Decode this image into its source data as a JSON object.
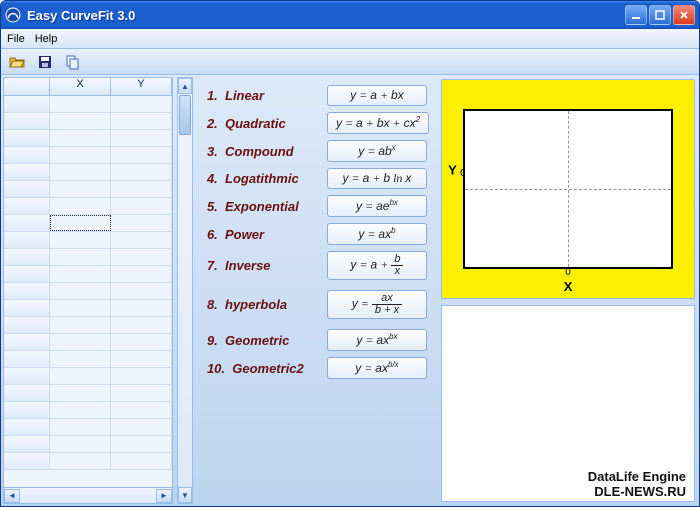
{
  "window": {
    "title": "Easy CurveFit 3.0"
  },
  "menu": {
    "file": "File",
    "help": "Help"
  },
  "grid": {
    "col_x": "X",
    "col_y": "Y"
  },
  "models": [
    {
      "n": "1.",
      "name": "Linear",
      "eq": "y = a + bx"
    },
    {
      "n": "2.",
      "name": "Quadratic",
      "eq": "y = a + bx + cx²"
    },
    {
      "n": "3.",
      "name": "Compound",
      "eq": "y = abˣ"
    },
    {
      "n": "4.",
      "name": "Logatithmic",
      "eq": "y = a + b ln x"
    },
    {
      "n": "5.",
      "name": "Exponential",
      "eq": "y = ae^{bx}"
    },
    {
      "n": "6.",
      "name": "Power",
      "eq": "y = axᵇ"
    },
    {
      "n": "7.",
      "name": "Inverse",
      "eq": "y = a + b/x"
    },
    {
      "n": "8.",
      "name": "hyperbola",
      "eq": "y = ax/(b + x)"
    },
    {
      "n": "9.",
      "name": "Geometric",
      "eq": "y = ax^{bx}"
    },
    {
      "n": "10.",
      "name": "Geometric2",
      "eq": "y = ax^{b/x}"
    }
  ],
  "plot": {
    "xlabel": "X",
    "ylabel": "Y",
    "xtick0": "0",
    "ytick0": "0"
  },
  "watermark": {
    "line1": "DataLife Engine",
    "line2": "DLE-NEWS.RU"
  }
}
